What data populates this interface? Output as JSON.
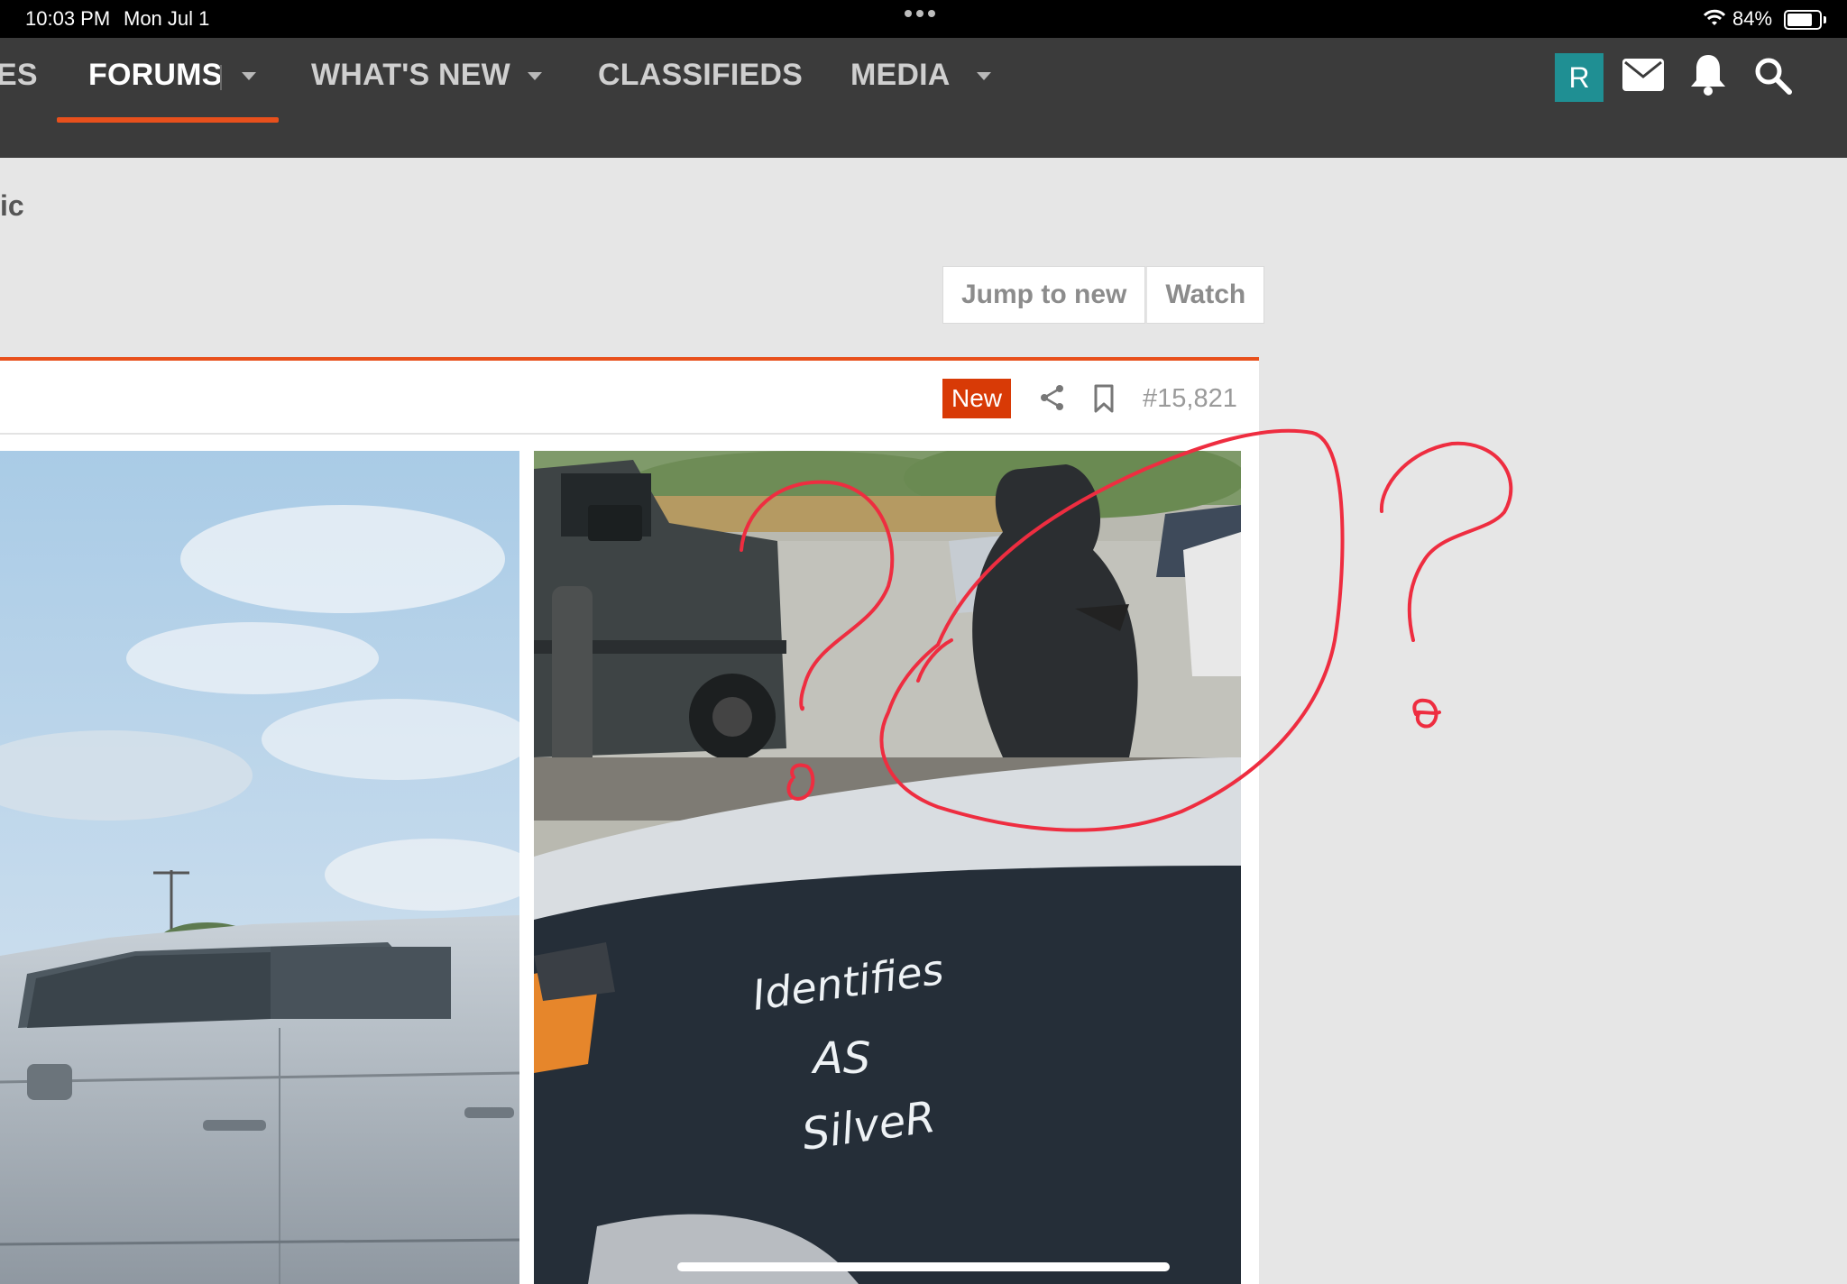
{
  "status_bar": {
    "time": "10:03 PM",
    "date": "Mon Jul 1",
    "battery": "84%",
    "battery_level": 0.84
  },
  "nav": {
    "partial_left": "ES",
    "items": [
      {
        "label": "FORUMS",
        "active": true
      },
      {
        "label": "WHAT'S NEW"
      },
      {
        "label": "CLASSIFIEDS"
      },
      {
        "label": "MEDIA"
      }
    ],
    "avatar_letter": "R",
    "icons": [
      "mail-icon",
      "bell-icon",
      "search-icon"
    ]
  },
  "page": {
    "breadcrumb_fragment": "ic",
    "buttons": {
      "jump_to_new": "Jump to new",
      "watch": "Watch"
    }
  },
  "post": {
    "badge": "New",
    "number": "#15,821",
    "image_text": [
      "Identifies",
      "AS",
      "SilveR"
    ]
  },
  "colors": {
    "accent": "#e8501c",
    "nav_bg": "#3b3b3b",
    "avatar_bg": "#1f8f93",
    "annotation": "#ee2d40"
  }
}
